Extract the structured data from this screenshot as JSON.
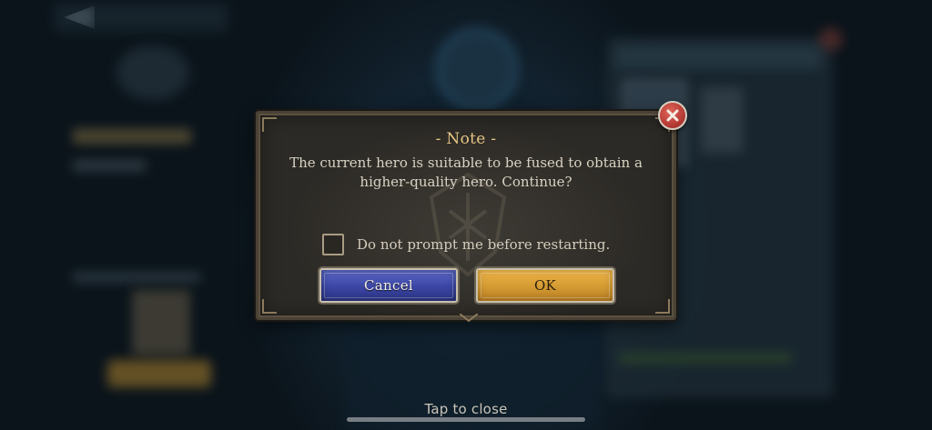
{
  "dialog": {
    "title": "- Note -",
    "message": "The current hero is suitable to be fused to obtain a higher-quality hero. Continue?",
    "checkbox_label": "Do not prompt me before restarting.",
    "checkbox_checked": false,
    "cancel_label": "Cancel",
    "ok_label": "OK"
  },
  "footer": {
    "tap_to_close": "Tap to close"
  },
  "colors": {
    "title_gold": "#e6c584",
    "cancel_blue": "#3b46a3",
    "ok_gold": "#d49a32",
    "close_red": "#b63c35"
  },
  "icons": {
    "close": "close-icon",
    "emblem": "shield-emblem-icon",
    "back": "back-arrow-icon"
  }
}
